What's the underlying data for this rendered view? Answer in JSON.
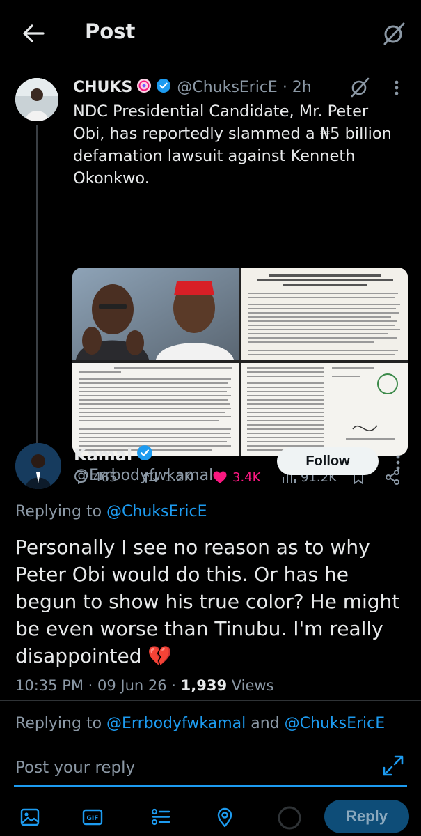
{
  "header": {
    "title": "Post",
    "back_icon": "arrow-left-icon",
    "grok_icon": "grok-icon"
  },
  "tweet": {
    "name": "CHUKS",
    "handle_time": "@ChuksEricE · 2h",
    "text": "NDC Presidential Candidate, Mr. Peter Obi, has reportedly slammed a ₦5 billion defamation lawsuit against Kenneth Okonkwo.",
    "media_doc_heading": "DEMAND FOR IMMEDIATE WITHDRAWAL OF FALSE, MALICIOUS AND DEFAMATORY PUBLICATIONS AGAINST MR. PETER OBI, PUBLIC APOLOGY AND UNDERTAKING",
    "actions": {
      "replies": "465",
      "reposts": "1.2K",
      "likes": "3.4K",
      "views": "91.2K"
    },
    "colors": {
      "like": "#f91880",
      "muted": "#8b98a5",
      "link": "#1d9bf0"
    }
  },
  "reply": {
    "name": "Kamal",
    "handle": "@Errbodyfwkamal",
    "follow_label": "Follow",
    "replying_label": "Replying to ",
    "replying_to": "@ChuksEricE",
    "text": "Personally I see no reason as to why Peter Obi would do this. Or has he begun to show his true color? He might be even worse than Tinubu. I'm really disappointed 💔",
    "time": "10:35 PM · 09 Jun 26 · ",
    "views_count": "1,939",
    "views_label": " Views"
  },
  "composer": {
    "replying_label": "Replying to ",
    "reply_to_1": "@Errbodyfwkamal",
    "and_label": " and ",
    "reply_to_2": "@ChuksEricE",
    "placeholder": "Post your reply",
    "reply_button": "Reply",
    "gif_label": "GIF"
  }
}
